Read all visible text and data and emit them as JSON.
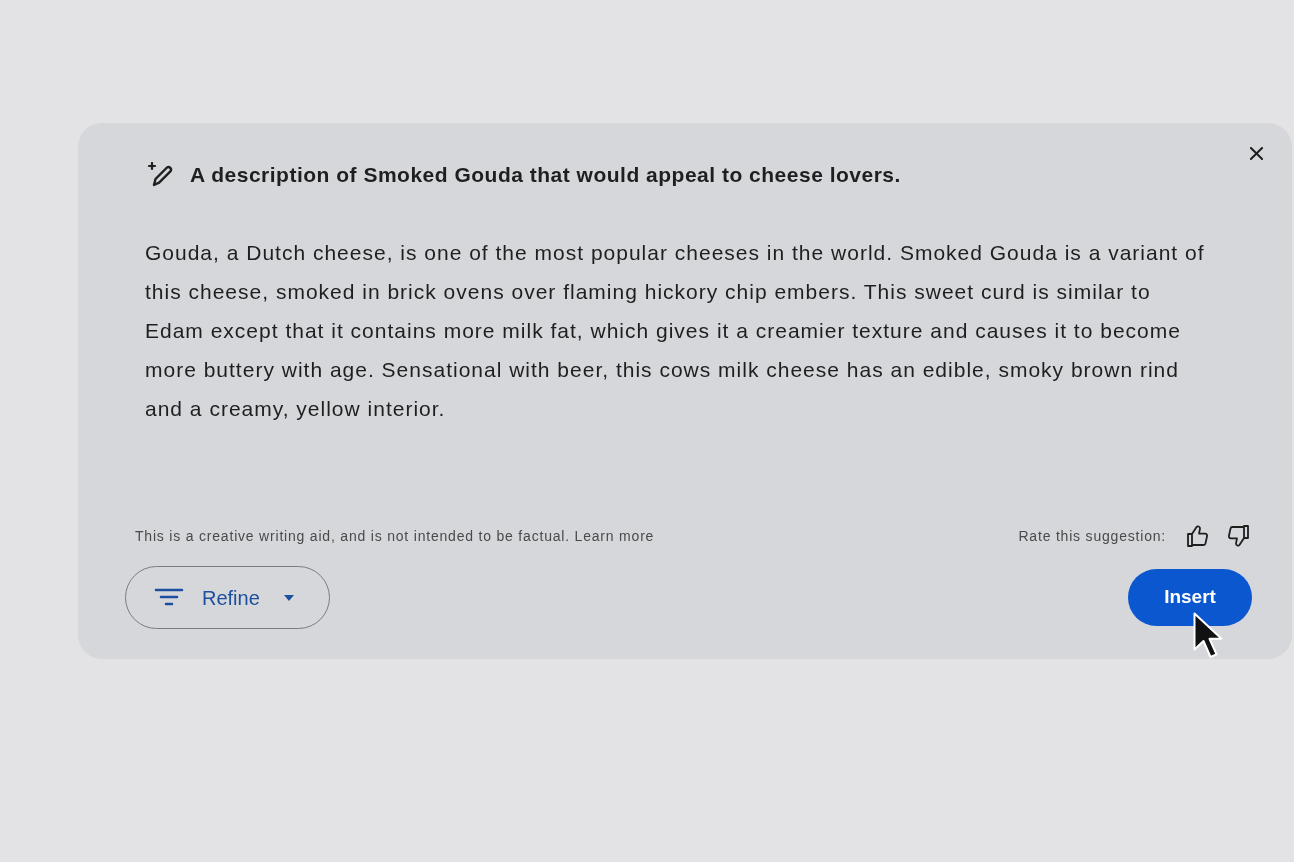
{
  "prompt": {
    "text": "A description of Smoked Gouda that would appeal to cheese lovers."
  },
  "suggestion": {
    "text": "Gouda, a Dutch cheese, is one of the most popular cheeses in the world. Smoked Gouda is a variant of this cheese, smoked in brick ovens over flaming hickory chip embers. This sweet curd is similar to Edam except that it contains more milk fat, which gives it a creamier texture and causes it to become more buttery with age. Sensational with beer, this cows milk cheese has an edible, smoky brown rind and a creamy, yellow interior."
  },
  "disclaimer": {
    "text": "This is a creative writing aid, and is not intended to be factual.",
    "link": "Learn more"
  },
  "rating": {
    "label": "Rate this suggestion:"
  },
  "refine_button": {
    "label": "Refine"
  },
  "insert_button": {
    "label": "Insert"
  }
}
